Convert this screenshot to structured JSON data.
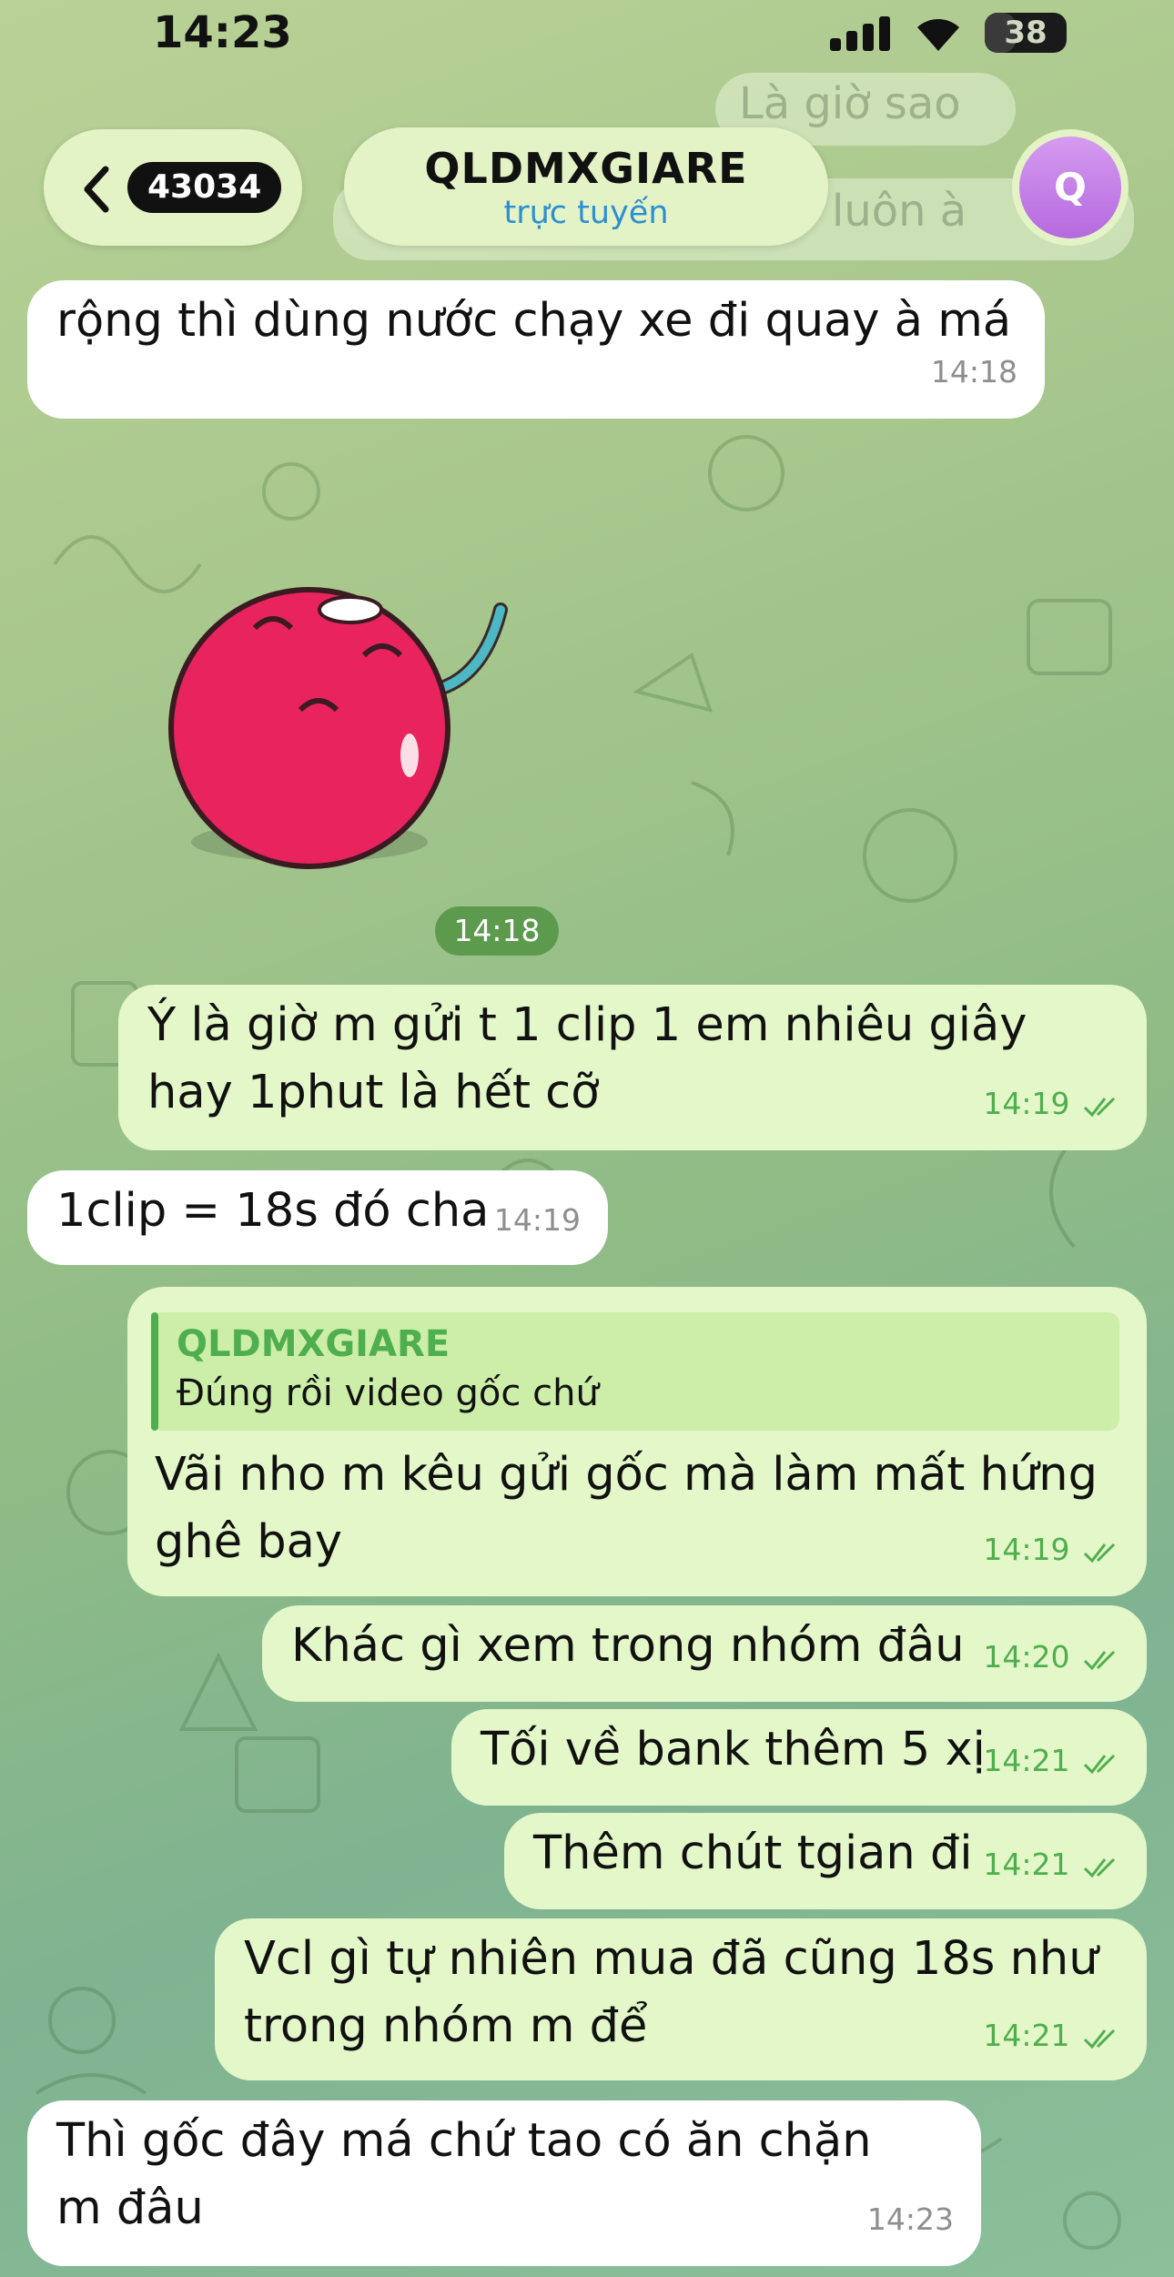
{
  "status": {
    "time": "14:23",
    "battery": "38",
    "battery_level": 0.38
  },
  "background_ghost": {
    "line1": "Là giờ sao",
    "line2": "luôn à"
  },
  "header": {
    "back_count": "43034",
    "title": "QLDMXGIARE",
    "subtitle": "trực tuyến",
    "avatar_letter": "Q"
  },
  "messages": [
    {
      "dir": "in",
      "text": "rộng thì dùng nước chạy xe đi quay à má",
      "time": "14:18"
    },
    {
      "type": "sticker",
      "time": "14:18"
    },
    {
      "dir": "out",
      "text": "Ý là giờ m gửi t 1 clip 1 em nhiêu giây hay 1phut là hết cỡ",
      "time": "14:19",
      "read": true
    },
    {
      "dir": "in",
      "text": "1clip = 18s đó cha",
      "time": "14:19"
    },
    {
      "dir": "out",
      "reply": {
        "name": "QLDMXGIARE",
        "text": "Đúng rồi video gốc chứ"
      },
      "text": "Vãi nho m kêu gửi gốc mà làm mất hứng ghê bay",
      "time": "14:19",
      "read": true
    },
    {
      "dir": "out",
      "text": "Khác gì xem trong nhóm đâu",
      "time": "14:20",
      "read": true
    },
    {
      "dir": "out",
      "text": "Tối về bank thêm 5 xị",
      "time": "14:21",
      "read": true
    },
    {
      "dir": "out",
      "text": "Thêm chút tgian đi",
      "time": "14:21",
      "read": true
    },
    {
      "dir": "out",
      "text": "Vcl gì tự nhiên mua đã cũng 18s như trong nhóm m để",
      "time": "14:21",
      "read": true
    },
    {
      "dir": "in",
      "text": "Thì gốc đây má chứ tao có ăn chặn m đâu",
      "time": "14:23"
    }
  ],
  "colors": {
    "incoming": "#ffffff",
    "outgoing": "#e3f7c8",
    "accent_green": "#4fae4e",
    "link_blue": "#2e8fd0"
  }
}
